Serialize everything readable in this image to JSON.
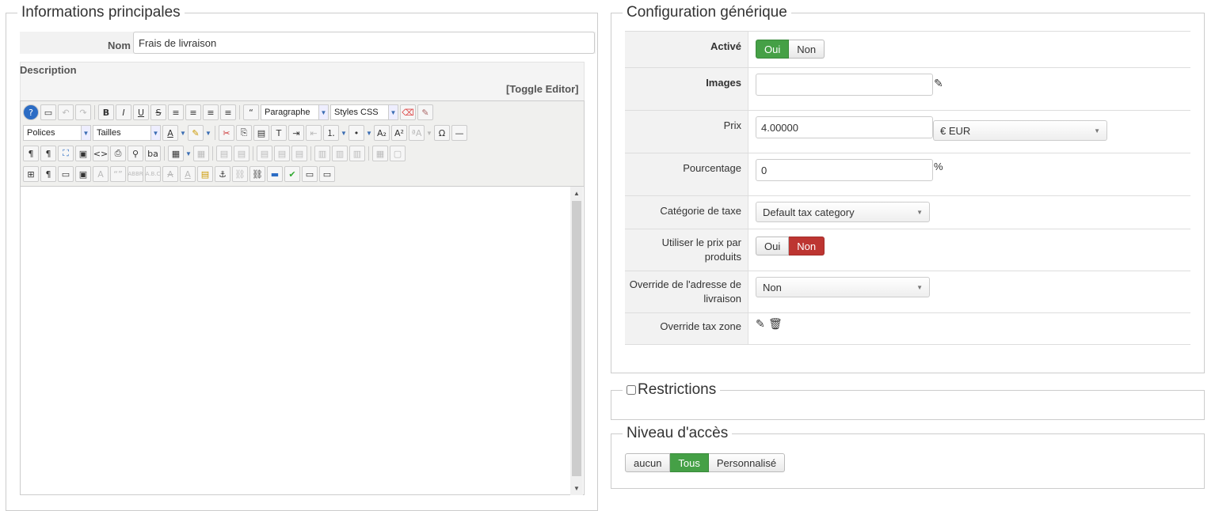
{
  "main": {
    "legend": "Informations principales",
    "nom_label": "Nom",
    "nom_value": "Frais de livraison",
    "description_label": "Description",
    "toggle_editor": "[Toggle Editor]",
    "editor": {
      "format_select": "Paragraphe",
      "styles_select": "Styles CSS",
      "font_select": "Polices",
      "size_select": "Tailles"
    }
  },
  "config": {
    "legend": "Configuration générique",
    "active_label": "Activé",
    "active_yes": "Oui",
    "active_no": "Non",
    "images_label": "Images",
    "images_value": "",
    "prix_label": "Prix",
    "prix_value": "4.00000",
    "currency": "€ EUR",
    "pourcentage_label": "Pourcentage",
    "pourcentage_value": "0",
    "percent_sign": "%",
    "tax_label": "Catégorie de taxe",
    "tax_value": "Default tax category",
    "use_product_price_label": "Utiliser le prix par produits",
    "use_yes": "Oui",
    "use_no": "Non",
    "override_address_label": "Override de l'adresse de livraison",
    "override_address_value": "Non",
    "override_tax_label": "Override tax zone"
  },
  "restrictions": {
    "label": "Restrictions"
  },
  "access": {
    "legend": "Niveau d'accès",
    "options": [
      "aucun",
      "Tous",
      "Personnalisé"
    ]
  },
  "colors": {
    "green": "#45a046",
    "red": "#bd3531"
  }
}
